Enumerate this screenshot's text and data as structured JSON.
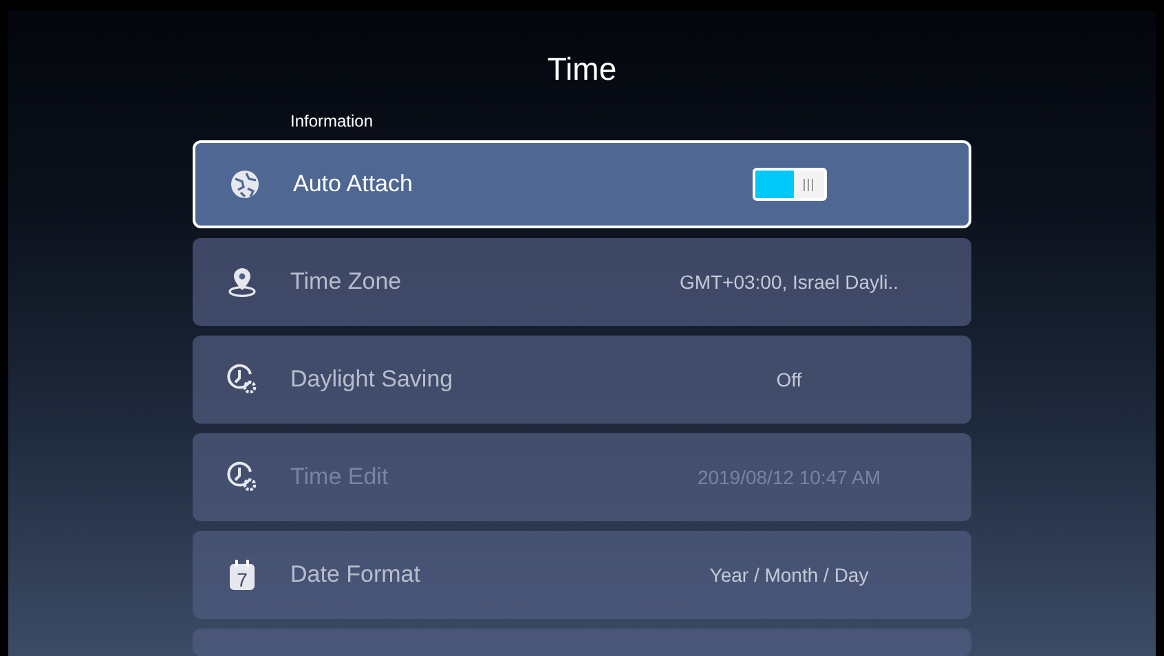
{
  "title": "Time",
  "section": "Information",
  "rows": [
    {
      "kind": "toggle",
      "label": "Auto Attach",
      "on": true,
      "selected": true,
      "disabled": false
    },
    {
      "kind": "value",
      "label": "Time Zone",
      "value": "GMT+03:00, Israel Dayli..",
      "selected": false,
      "disabled": false
    },
    {
      "kind": "value",
      "label": "Daylight Saving",
      "value": "Off",
      "selected": false,
      "disabled": false
    },
    {
      "kind": "value",
      "label": "Time Edit",
      "value": "2019/08/12 10:47 AM",
      "selected": false,
      "disabled": true
    },
    {
      "kind": "value",
      "icon_text": "7",
      "label": "Date Format",
      "value": "Year / Month / Day",
      "selected": false,
      "disabled": false
    }
  ]
}
